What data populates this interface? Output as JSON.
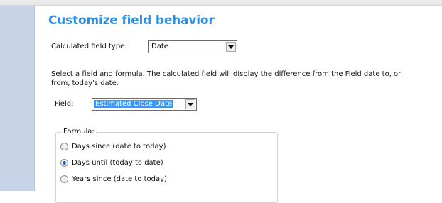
{
  "title": "Customize field behavior",
  "calculated_type": {
    "label": "Calculated field type:",
    "value": "Date"
  },
  "description": "Select a field and formula. The calculated field will display the difference from the Field date to, or from, today's date.",
  "field": {
    "label": "Field:",
    "value": "Estimated Close Date"
  },
  "formula": {
    "title": "Formula:",
    "options": [
      {
        "label": "Days since (date to today)",
        "checked": false
      },
      {
        "label": "Days until (today to date)",
        "checked": true
      },
      {
        "label": "Years since (date to today)",
        "checked": false
      }
    ]
  },
  "colors": {
    "heading": "#2f8fe0",
    "sidebar": "#c7d3e6",
    "selection": "#3399ff"
  },
  "icons": {
    "dropdown": "chevron-down-icon",
    "radio": "radio-icon"
  }
}
